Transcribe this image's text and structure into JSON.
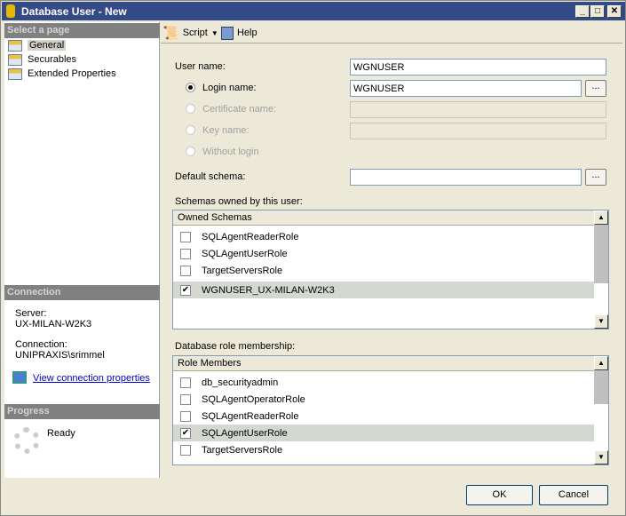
{
  "window": {
    "title": "Database User - New",
    "min": "_",
    "max": "□",
    "close": "✕"
  },
  "left": {
    "select_header": "Select a page",
    "pages": [
      "General",
      "Securables",
      "Extended Properties"
    ],
    "connection_header": "Connection",
    "server_label": "Server:",
    "server_value": "UX-MILAN-W2K3",
    "connection_label": "Connection:",
    "connection_value": "UNIPRAXIS\\srimmel",
    "view_link": "View connection properties",
    "progress_header": "Progress",
    "progress_status": "Ready"
  },
  "toolbar": {
    "script": "Script",
    "help": "Help"
  },
  "form": {
    "user_name_label": "User name:",
    "user_name_value": "WGNUSER",
    "login_name_label": "Login name:",
    "login_name_value": "WGNUSER",
    "certificate_label": "Certificate name:",
    "key_label": "Key name:",
    "without_login_label": "Without login",
    "default_schema_label": "Default schema:",
    "default_schema_value": "",
    "browse": "..."
  },
  "schemas": {
    "label": "Schemas owned by this user:",
    "header": "Owned Schemas",
    "rows": [
      {
        "name": "SQLAgentReaderRole",
        "checked": false
      },
      {
        "name": "SQLAgentUserRole",
        "checked": false
      },
      {
        "name": "TargetServersRole",
        "checked": false
      },
      {
        "name": "WGNUSER_UX-MILAN-W2K3",
        "checked": true
      }
    ]
  },
  "roles": {
    "label": "Database role membership:",
    "header": "Role Members",
    "rows": [
      {
        "name": "db_securityadmin",
        "checked": false
      },
      {
        "name": "SQLAgentOperatorRole",
        "checked": false
      },
      {
        "name": "SQLAgentReaderRole",
        "checked": false
      },
      {
        "name": "SQLAgentUserRole",
        "checked": true
      },
      {
        "name": "TargetServersRole",
        "checked": false
      }
    ]
  },
  "buttons": {
    "ok": "OK",
    "cancel": "Cancel"
  }
}
